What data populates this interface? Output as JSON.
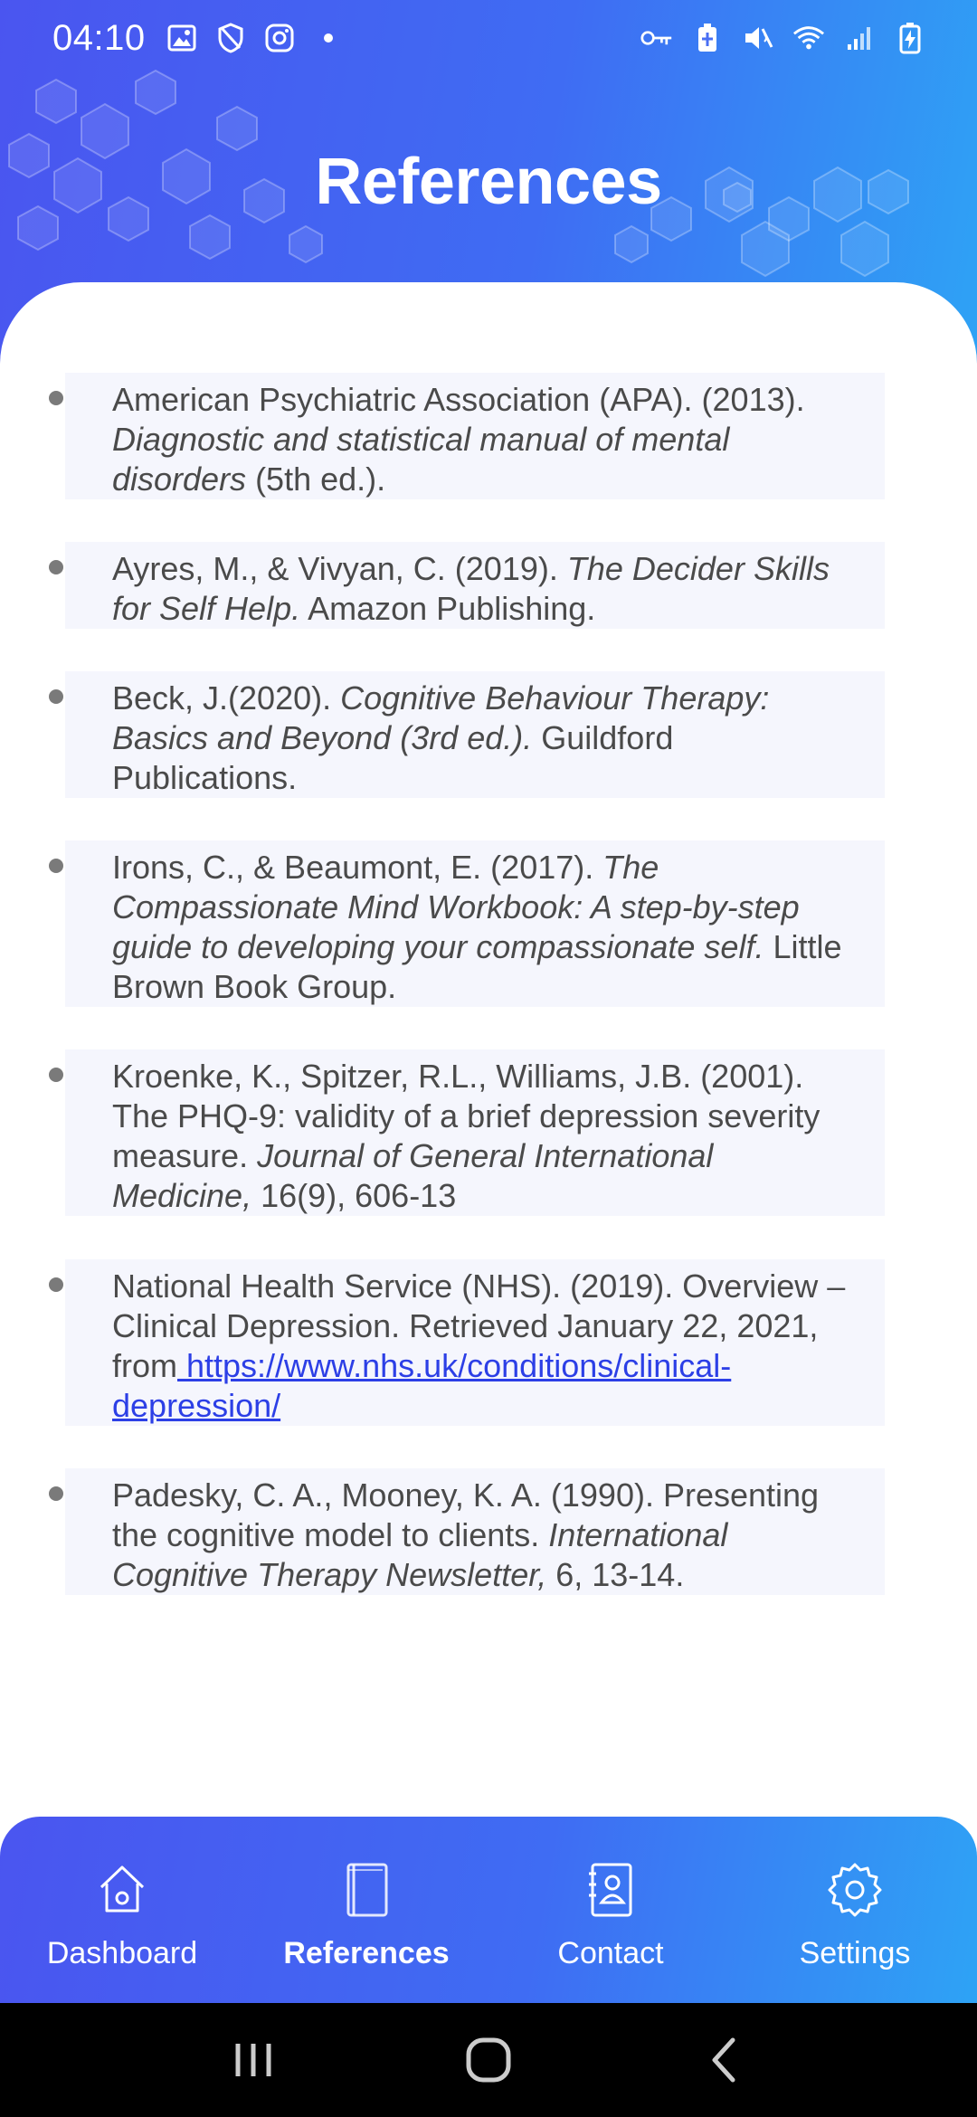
{
  "status_bar": {
    "time": "04:10",
    "left_icons": [
      "gallery-icon",
      "shield-icon",
      "instagram-icon",
      "dot-icon"
    ],
    "right_icons": [
      "vpn-key-icon",
      "battery-saver-icon",
      "mute-icon",
      "wifi-icon",
      "signal-icon",
      "battery-charging-icon"
    ]
  },
  "header": {
    "title": "References"
  },
  "references": [
    {
      "parts": [
        {
          "text": "American Psychiatric Association (APA). (2013). ",
          "style": "normal"
        },
        {
          "text": "Diagnostic and statistical manual of mental disorders",
          "style": "italic"
        },
        {
          "text": " (5th ed.).",
          "style": "normal"
        }
      ]
    },
    {
      "parts": [
        {
          "text": "Ayres, M., & Vivyan, C. (2019). ",
          "style": "normal"
        },
        {
          "text": "The Decider Skills for Self Help.",
          "style": "italic"
        },
        {
          "text": " Amazon Publishing.",
          "style": "normal"
        }
      ]
    },
    {
      "parts": [
        {
          "text": "Beck, J.(2020). ",
          "style": "normal"
        },
        {
          "text": "Cognitive Behaviour Therapy: Basics and Beyond (3rd ed.).",
          "style": "italic"
        },
        {
          "text": "  Guildford Publications.",
          "style": "normal"
        }
      ]
    },
    {
      "parts": [
        {
          "text": "Irons, C., & Beaumont, E. (2017).  ",
          "style": "normal"
        },
        {
          "text": "The Compassionate Mind Workbook: A step-by-step guide to developing your compassionate self.",
          "style": "italic"
        },
        {
          "text": " Little Brown Book Group.",
          "style": "normal"
        }
      ]
    },
    {
      "parts": [
        {
          "text": "Kroenke, K., Spitzer, R.L., Williams, J.B. (2001). The PHQ-9: validity of a brief depression severity measure.  ",
          "style": "normal"
        },
        {
          "text": "Journal of General International Medicine,",
          "style": "italic"
        },
        {
          "text": " 16(9), 606-13",
          "style": "normal"
        }
      ]
    },
    {
      "parts": [
        {
          "text": "National Health Service (NHS). (2019). Overview – Clinical Depression. Retrieved January 22, 2021, from",
          "style": "normal"
        },
        {
          "text": " https://www.nhs.uk/conditions/clinical-depression/",
          "style": "link"
        }
      ]
    },
    {
      "parts": [
        {
          "text": "Padesky, C. A., Mooney, K. A. (1990). Presenting the cognitive model to clients. ",
          "style": "normal"
        },
        {
          "text": "International Cognitive Therapy Newsletter,",
          "style": "italic"
        },
        {
          "text": " 6, 13-14.",
          "style": "normal"
        }
      ]
    }
  ],
  "bottom_nav": {
    "items": [
      {
        "label": "Dashboard",
        "icon": "home-icon",
        "active": false
      },
      {
        "label": "References",
        "icon": "book-icon",
        "active": true
      },
      {
        "label": "Contact",
        "icon": "contact-card-icon",
        "active": false
      },
      {
        "label": "Settings",
        "icon": "gear-icon",
        "active": false
      }
    ]
  },
  "system_nav": {
    "buttons": [
      "recents-icon",
      "home-button-icon",
      "back-icon"
    ]
  },
  "colors": {
    "gradient_start": "#4a55f0",
    "gradient_end": "#2ea3f5",
    "link": "#2c3fe6",
    "ref_background": "#f5f6fd",
    "text": "#4a4a4a"
  }
}
